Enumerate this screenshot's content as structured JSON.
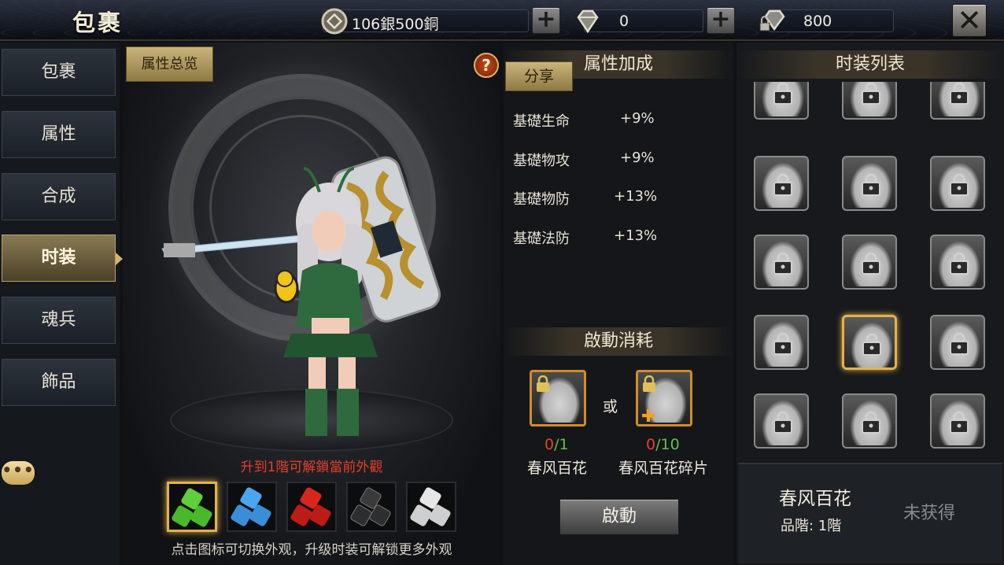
{
  "header": {
    "title": "包裹",
    "silver": "106銀500銅",
    "diamond": "0",
    "bound_diamond": "800"
  },
  "nav": {
    "items": [
      {
        "label": "包裹"
      },
      {
        "label": "属性"
      },
      {
        "label": "合成"
      },
      {
        "label": "时装"
      },
      {
        "label": "魂兵"
      },
      {
        "label": "飾品"
      }
    ],
    "active": "时装"
  },
  "char_panel": {
    "overview_label": "属性总览",
    "help_label": "?",
    "unlock_hint": "升到1階可解鎖當前外觀",
    "tip": "点击图标可切换外观，升级时装可解锁更多外观",
    "swatches": [
      "green",
      "blue",
      "red",
      "dark",
      "white"
    ],
    "swatch_colors": [
      "#5fcf3c",
      "#4aa6f0",
      "#d8261e",
      "#3a3a3a",
      "#d8d8d8"
    ],
    "selected_swatch": "green"
  },
  "attr_panel": {
    "title": "属性加成",
    "share_label": "分享",
    "rows": [
      {
        "name": "基礎生命",
        "value": "+9%"
      },
      {
        "name": "基礎物攻",
        "value": "+9%"
      },
      {
        "name": "基礎物防",
        "value": "+13%"
      },
      {
        "name": "基礎法防",
        "value": "+13%"
      }
    ],
    "cost_title": "啟動消耗",
    "or_label": "或",
    "costs": [
      {
        "name": "春风百花",
        "have": "0",
        "need": "1"
      },
      {
        "name": "春风百花碎片",
        "have": "0",
        "need": "10"
      }
    ],
    "activate_label": "啟動"
  },
  "costume_list": {
    "title": "时装列表",
    "selected_index": 10,
    "item_count": 15,
    "detail": {
      "name": "春风百花",
      "rank": "品階: 1階",
      "status": "未获得"
    }
  },
  "colors": {
    "accent_gold": "#e4b24a",
    "have_red": "#e3402c",
    "need_green": "#5ec24a"
  }
}
